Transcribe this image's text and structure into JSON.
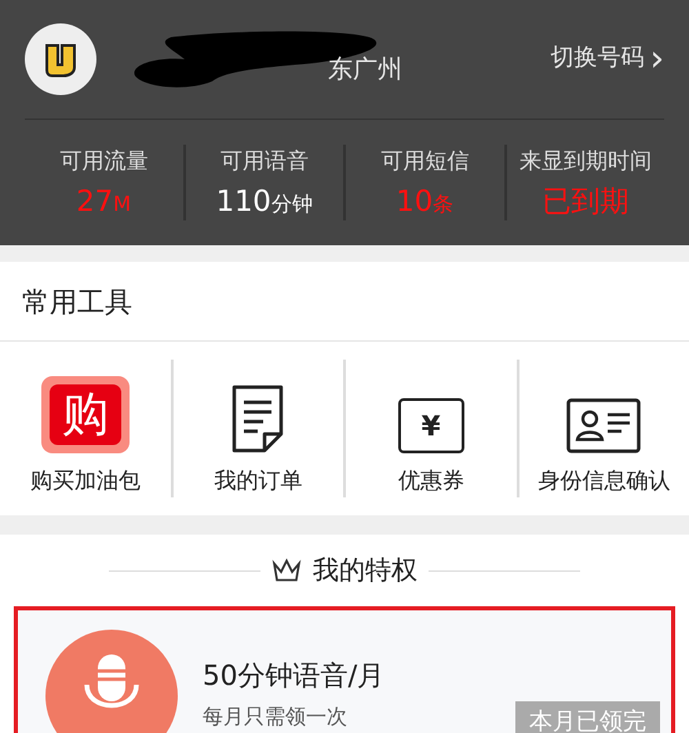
{
  "account": {
    "location": "东广州",
    "switch_label": "切换号码",
    "switch_arrow": "›"
  },
  "stats": [
    {
      "label": "可用流量",
      "value": "27",
      "unit": "M",
      "alert": true
    },
    {
      "label": "可用语音",
      "value": "110",
      "unit": "分钟",
      "alert": false
    },
    {
      "label": "可用短信",
      "value": "10",
      "unit": "条",
      "alert": true
    },
    {
      "label": "来显到期时间",
      "value": "已到期",
      "alert": true
    }
  ],
  "tools": {
    "title": "常用工具",
    "items": [
      {
        "kind": "buy",
        "glyph": "购",
        "label": "购买加油包"
      },
      {
        "kind": "order",
        "label": "我的订单"
      },
      {
        "kind": "coupon",
        "glyph": "¥",
        "label": "优惠券"
      },
      {
        "kind": "id",
        "label": "身份信息确认"
      }
    ]
  },
  "privileges": {
    "title": "我的特权",
    "card": {
      "title": "50分钟语音/月",
      "subtitle": "每月只需领一次",
      "button": "本月已领完",
      "highlighted": true
    }
  }
}
